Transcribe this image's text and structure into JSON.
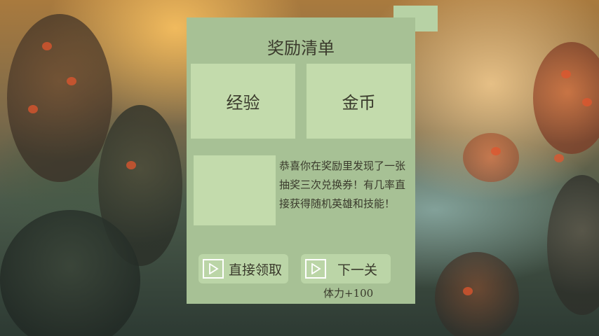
{
  "panel": {
    "title": "奖励清单",
    "rewards": [
      {
        "label": "经验"
      },
      {
        "label": "金币"
      }
    ],
    "description": "恭喜你在奖励里发现了一张抽奖三次兑换券！有几率直接获得随机英雄和技能！",
    "buttons": {
      "claim_label": "直接领取",
      "next_label": "下一关"
    },
    "stamina_text": "体力+100"
  },
  "colors": {
    "panel": "#a7c195",
    "tile": "#c3dbac",
    "button": "#bbd5a7",
    "text": "#3a3a2c"
  },
  "icons": [
    "play-icon"
  ]
}
